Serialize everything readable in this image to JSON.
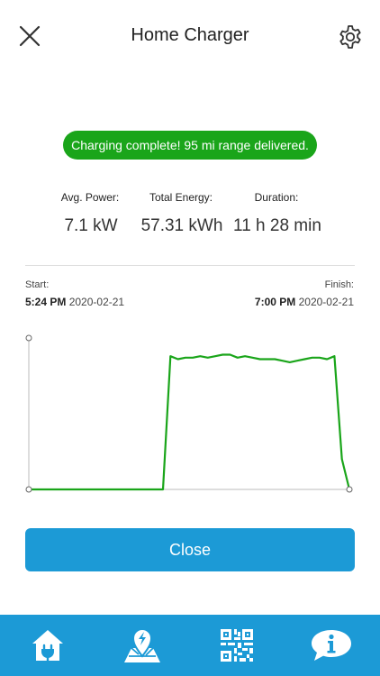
{
  "header": {
    "title": "Home Charger",
    "close_icon": "close-icon",
    "settings_icon": "gear-icon"
  },
  "status": {
    "message": "Charging complete! 95 mi range delivered.",
    "color": "#1aa51a"
  },
  "stats": [
    {
      "label": "Avg. Power:",
      "value": "7.1 kW"
    },
    {
      "label": "Total Energy:",
      "value": "57.31 kWh"
    },
    {
      "label": "Duration:",
      "value": "11 h 28 min"
    }
  ],
  "session": {
    "start_label": "Start:",
    "start_time": "5:24 PM",
    "start_date": "2020-02-21",
    "finish_label": "Finish:",
    "finish_time": "7:00 PM",
    "finish_date": "2020-02-21"
  },
  "chart_data": {
    "type": "line",
    "series": [
      {
        "color": "#1aa51a",
        "values": [
          0,
          0,
          0,
          0,
          0,
          0,
          0,
          0,
          0,
          0,
          0,
          0,
          0,
          0,
          0,
          0,
          0,
          0,
          0,
          0.88,
          0.86,
          0.87,
          0.87,
          0.88,
          0.87,
          0.88,
          0.89,
          0.89,
          0.87,
          0.88,
          0.87,
          0.86,
          0.86,
          0.86,
          0.85,
          0.84,
          0.85,
          0.86,
          0.87,
          0.87,
          0.86,
          0.88,
          0.2,
          0.0
        ]
      }
    ],
    "grid": false
  },
  "actions": {
    "close_label": "Close",
    "accent": "#1c9ad6"
  },
  "tabbar": {
    "color": "#1c9ad6",
    "icons": [
      "home-charger-icon",
      "map-pin-icon",
      "qr-code-icon",
      "info-chat-icon"
    ]
  }
}
